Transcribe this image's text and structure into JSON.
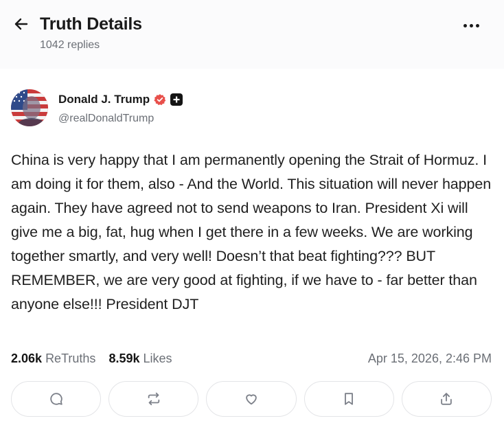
{
  "header": {
    "title": "Truth Details",
    "replies": "1042 replies",
    "back_icon": "arrow-left-icon",
    "more_icon": "more-horizontal-icon"
  },
  "post": {
    "author": {
      "name": "Donald J. Trump",
      "handle": "@realDonaldTrump",
      "verified_color": "#e8504b"
    },
    "text": "China is very happy that I am permanently opening the Strait of Hormuz. I am doing it for them, also - And the World. This situation will never happen again. They have agreed not to send weapons to Iran. President Xi will give me a big, fat, hug when I get there in a few weeks. We are working together smartly, and very well! Doesn’t that beat fighting??? BUT REMEMBER, we are very good at fighting, if we have to - far better than anyone else!!! President DJT",
    "stats": {
      "retruths_count": "2.06k",
      "retruths_label": "ReTruths",
      "likes_count": "8.59k",
      "likes_label": "Likes",
      "timestamp": "Apr 15, 2026, 2:46 PM"
    }
  },
  "actions": [
    {
      "icon": "reply-icon"
    },
    {
      "icon": "retruth-icon"
    },
    {
      "icon": "heart-icon"
    },
    {
      "icon": "bookmark-icon"
    },
    {
      "icon": "share-icon"
    }
  ]
}
